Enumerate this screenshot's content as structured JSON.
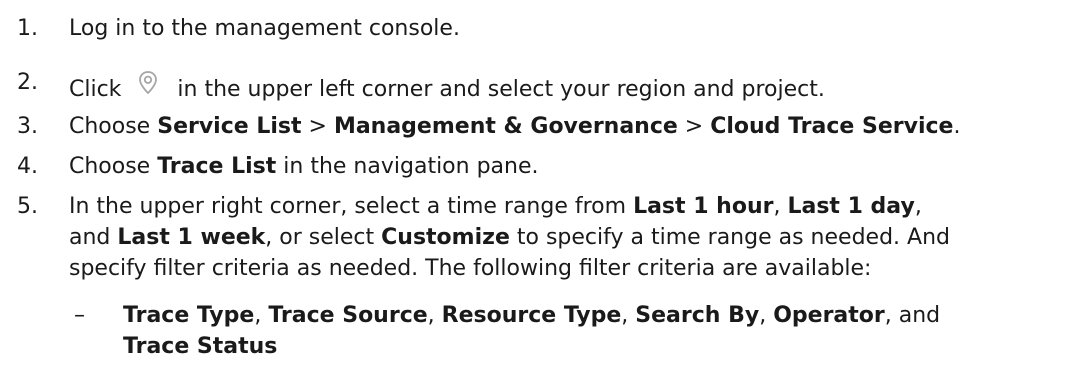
{
  "steps": [
    {
      "num": "1.",
      "parts": [
        {
          "t": "Log in to the management console."
        }
      ]
    },
    {
      "num": "2.",
      "parts": [
        {
          "t": "Click "
        },
        {
          "icon": "location-pin-icon"
        },
        {
          "t": " in the upper left corner and select your region and project."
        }
      ]
    },
    {
      "num": "3.",
      "parts": [
        {
          "t": "Choose "
        },
        {
          "b": "Service List"
        },
        {
          "t": " > "
        },
        {
          "b": "Management & Governance"
        },
        {
          "t": " > "
        },
        {
          "b": "Cloud Trace Service"
        },
        {
          "t": "."
        }
      ]
    },
    {
      "num": "4.",
      "parts": [
        {
          "t": "Choose "
        },
        {
          "b": "Trace List"
        },
        {
          "t": " in the navigation pane."
        }
      ]
    },
    {
      "num": "5.",
      "lines": [
        [
          {
            "t": "In the upper right corner, select a time range from "
          },
          {
            "b": "Last 1 hour"
          },
          {
            "t": ", "
          },
          {
            "b": "Last 1 day"
          },
          {
            "t": ","
          }
        ],
        [
          {
            "t": "and "
          },
          {
            "b": "Last 1 week"
          },
          {
            "t": ", or select "
          },
          {
            "b": "Customize"
          },
          {
            "t": " to specify a time range as needed. And"
          }
        ],
        [
          {
            "t": "specify filter criteria as needed. The following filter criteria are available:"
          }
        ]
      ]
    }
  ],
  "sub_items": [
    {
      "dash": "–",
      "lines": [
        [
          {
            "b": "Trace Type"
          },
          {
            "t": ", "
          },
          {
            "b": "Trace Source"
          },
          {
            "t": ", "
          },
          {
            "b": "Resource Type"
          },
          {
            "t": ", "
          },
          {
            "b": "Search By"
          },
          {
            "t": ", "
          },
          {
            "b": "Operator"
          },
          {
            "t": ", and"
          }
        ],
        [
          {
            "b": "Trace Status"
          }
        ]
      ]
    }
  ],
  "icon_color": "#a6a6a6"
}
